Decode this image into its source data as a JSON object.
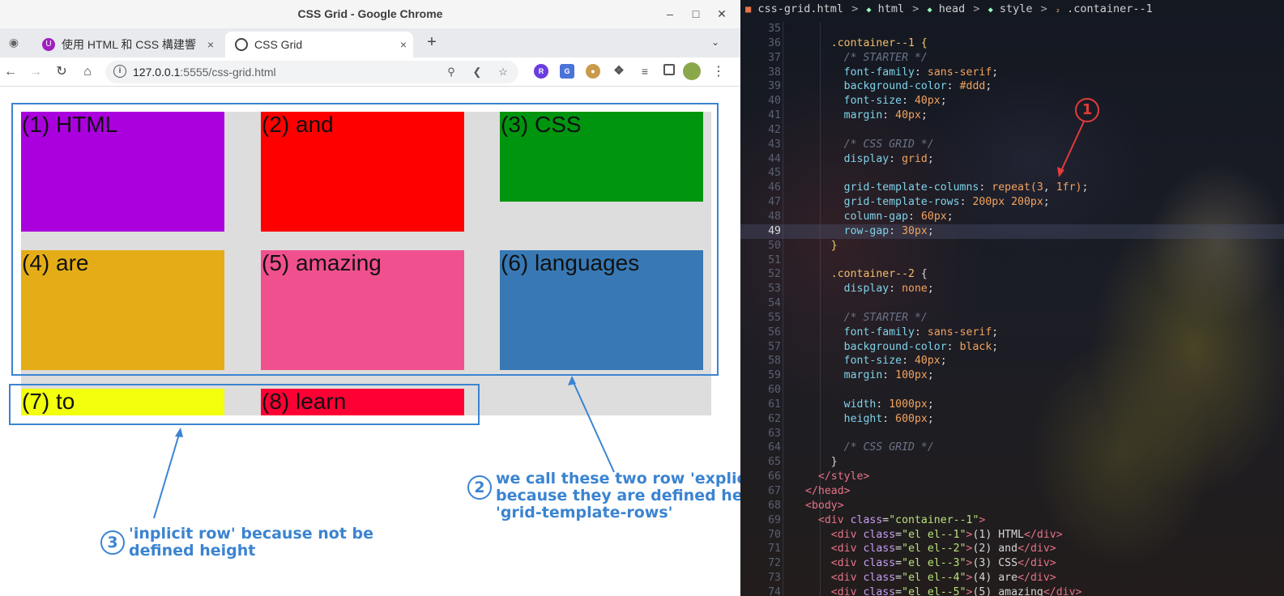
{
  "browser": {
    "window_title": "CSS Grid - Google Chrome",
    "tabs": [
      {
        "label": "使用 HTML 和 CSS 構建響",
        "active": false
      },
      {
        "label": "CSS Grid",
        "active": true
      }
    ],
    "url_host": "127.0.0.1",
    "url_rest": ":5555/css-grid.html",
    "new_tab": "+",
    "tab_close": "×"
  },
  "grid_items": [
    {
      "label": "(1) HTML",
      "color": "#aa00dd"
    },
    {
      "label": "(2) and",
      "color": "#ff0000"
    },
    {
      "label": "(3) CSS",
      "color": "#00950f"
    },
    {
      "label": "(4) are",
      "color": "#e4ad17"
    },
    {
      "label": "(5) amazing",
      "color": "#f1508f"
    },
    {
      "label": "(6) languages",
      "color": "#3879b5"
    },
    {
      "label": "(7) to",
      "color": "#f2ff0d"
    },
    {
      "label": "(8) learn",
      "color": "#ff0035"
    }
  ],
  "annotations": {
    "explicit_num": "2",
    "explicit_text": [
      "we call these two row 'explicit rows'",
      "because they are defined height by",
      "'grid-template-rows'"
    ],
    "implicit_num": "3",
    "implicit_text": [
      "'inplicit row' because not be",
      "defined height"
    ],
    "editor_num": "1"
  },
  "editor": {
    "breadcrumb": [
      "css-grid.html",
      "html",
      "head",
      "style",
      ".container--1"
    ],
    "current_line": 49,
    "lines": [
      {
        "n": 35,
        "parts": []
      },
      {
        "n": 36,
        "parts": [
          [
            "sel",
            "    .container--1 "
          ],
          [
            "br",
            "{"
          ]
        ]
      },
      {
        "n": 37,
        "parts": [
          [
            "cm",
            "      /* STARTER */"
          ]
        ]
      },
      {
        "n": 38,
        "parts": [
          [
            "prop",
            "      font-family"
          ],
          [
            "pl",
            ": "
          ],
          [
            "val",
            "sans-serif"
          ],
          [
            "pl",
            ";"
          ]
        ]
      },
      {
        "n": 39,
        "parts": [
          [
            "prop",
            "      background-color"
          ],
          [
            "pl",
            ": "
          ],
          [
            "val",
            "#ddd"
          ],
          [
            "pl",
            ";"
          ]
        ]
      },
      {
        "n": 40,
        "parts": [
          [
            "prop",
            "      font-size"
          ],
          [
            "pl",
            ": "
          ],
          [
            "val",
            "40px"
          ],
          [
            "pl",
            ";"
          ]
        ]
      },
      {
        "n": 41,
        "parts": [
          [
            "prop",
            "      margin"
          ],
          [
            "pl",
            ": "
          ],
          [
            "val",
            "40px"
          ],
          [
            "pl",
            ";"
          ]
        ]
      },
      {
        "n": 42,
        "parts": []
      },
      {
        "n": 43,
        "parts": [
          [
            "cm",
            "      /* CSS GRID */"
          ]
        ]
      },
      {
        "n": 44,
        "parts": [
          [
            "prop",
            "      display"
          ],
          [
            "pl",
            ": "
          ],
          [
            "val",
            "grid"
          ],
          [
            "pl",
            ";"
          ]
        ]
      },
      {
        "n": 45,
        "parts": []
      },
      {
        "n": 46,
        "parts": [
          [
            "prop",
            "      grid-template-columns"
          ],
          [
            "pl",
            ": "
          ],
          [
            "val",
            "repeat("
          ],
          [
            "val",
            "3"
          ],
          [
            "pl",
            ", "
          ],
          [
            "val",
            "1fr"
          ],
          [
            "val",
            ")"
          ],
          [
            "pl",
            ";"
          ]
        ]
      },
      {
        "n": 47,
        "parts": [
          [
            "prop",
            "      grid-template-rows"
          ],
          [
            "pl",
            ": "
          ],
          [
            "val",
            "200px 200px"
          ],
          [
            "pl",
            ";"
          ]
        ]
      },
      {
        "n": 48,
        "parts": [
          [
            "prop",
            "      column-gap"
          ],
          [
            "pl",
            ": "
          ],
          [
            "val",
            "60px"
          ],
          [
            "pl",
            ";"
          ]
        ]
      },
      {
        "n": 49,
        "parts": [
          [
            "prop",
            "      row-gap"
          ],
          [
            "pl",
            ": "
          ],
          [
            "val",
            "30px"
          ],
          [
            "pl",
            ";"
          ]
        ]
      },
      {
        "n": 50,
        "parts": [
          [
            "br",
            "    }"
          ]
        ]
      },
      {
        "n": 51,
        "parts": []
      },
      {
        "n": 52,
        "parts": [
          [
            "sel",
            "    .container--2 "
          ],
          [
            "pl",
            "{"
          ]
        ]
      },
      {
        "n": 53,
        "parts": [
          [
            "prop",
            "      display"
          ],
          [
            "pl",
            ": "
          ],
          [
            "val",
            "none"
          ],
          [
            "pl",
            ";"
          ]
        ]
      },
      {
        "n": 54,
        "parts": []
      },
      {
        "n": 55,
        "parts": [
          [
            "cm",
            "      /* STARTER */"
          ]
        ]
      },
      {
        "n": 56,
        "parts": [
          [
            "prop",
            "      font-family"
          ],
          [
            "pl",
            ": "
          ],
          [
            "val",
            "sans-serif"
          ],
          [
            "pl",
            ";"
          ]
        ]
      },
      {
        "n": 57,
        "parts": [
          [
            "prop",
            "      background-color"
          ],
          [
            "pl",
            ": "
          ],
          [
            "val",
            "black"
          ],
          [
            "pl",
            ";"
          ]
        ]
      },
      {
        "n": 58,
        "parts": [
          [
            "prop",
            "      font-size"
          ],
          [
            "pl",
            ": "
          ],
          [
            "val",
            "40px"
          ],
          [
            "pl",
            ";"
          ]
        ]
      },
      {
        "n": 59,
        "parts": [
          [
            "prop",
            "      margin"
          ],
          [
            "pl",
            ": "
          ],
          [
            "val",
            "100px"
          ],
          [
            "pl",
            ";"
          ]
        ]
      },
      {
        "n": 60,
        "parts": []
      },
      {
        "n": 61,
        "parts": [
          [
            "prop",
            "      width"
          ],
          [
            "pl",
            ": "
          ],
          [
            "val",
            "1000px"
          ],
          [
            "pl",
            ";"
          ]
        ]
      },
      {
        "n": 62,
        "parts": [
          [
            "prop",
            "      height"
          ],
          [
            "pl",
            ": "
          ],
          [
            "val",
            "600px"
          ],
          [
            "pl",
            ";"
          ]
        ]
      },
      {
        "n": 63,
        "parts": []
      },
      {
        "n": 64,
        "parts": [
          [
            "cm",
            "      /* CSS GRID */"
          ]
        ]
      },
      {
        "n": 65,
        "parts": [
          [
            "pl",
            "    }"
          ]
        ]
      },
      {
        "n": 66,
        "parts": [
          [
            "tag",
            "  </style>"
          ]
        ]
      },
      {
        "n": 67,
        "parts": [
          [
            "tag",
            "</head>"
          ]
        ]
      },
      {
        "n": 68,
        "parts": [
          [
            "tag",
            "<body>"
          ]
        ]
      },
      {
        "n": 69,
        "parts": [
          [
            "tag",
            "  <div "
          ],
          [
            "attr",
            "class"
          ],
          [
            "pl",
            "="
          ],
          [
            "str",
            "\"container--1\""
          ],
          [
            "tag",
            ">"
          ]
        ]
      },
      {
        "n": 70,
        "parts": [
          [
            "tag",
            "    <div "
          ],
          [
            "attr",
            "class"
          ],
          [
            "pl",
            "="
          ],
          [
            "str",
            "\"el el--1\""
          ],
          [
            "tag",
            ">"
          ],
          [
            "pl",
            "(1) HTML"
          ],
          [
            "tag",
            "</div>"
          ]
        ]
      },
      {
        "n": 71,
        "parts": [
          [
            "tag",
            "    <div "
          ],
          [
            "attr",
            "class"
          ],
          [
            "pl",
            "="
          ],
          [
            "str",
            "\"el el--2\""
          ],
          [
            "tag",
            ">"
          ],
          [
            "pl",
            "(2) and"
          ],
          [
            "tag",
            "</div>"
          ]
        ]
      },
      {
        "n": 72,
        "parts": [
          [
            "tag",
            "    <div "
          ],
          [
            "attr",
            "class"
          ],
          [
            "pl",
            "="
          ],
          [
            "str",
            "\"el el--3\""
          ],
          [
            "tag",
            ">"
          ],
          [
            "pl",
            "(3) CSS"
          ],
          [
            "tag",
            "</div>"
          ]
        ]
      },
      {
        "n": 73,
        "parts": [
          [
            "tag",
            "    <div "
          ],
          [
            "attr",
            "class"
          ],
          [
            "pl",
            "="
          ],
          [
            "str",
            "\"el el--4\""
          ],
          [
            "tag",
            ">"
          ],
          [
            "pl",
            "(4) are"
          ],
          [
            "tag",
            "</div>"
          ]
        ]
      },
      {
        "n": 74,
        "parts": [
          [
            "tag",
            "    <div "
          ],
          [
            "attr",
            "class"
          ],
          [
            "pl",
            "="
          ],
          [
            "str",
            "\"el el--5\""
          ],
          [
            "tag",
            ">"
          ],
          [
            "pl",
            "(5) amazing"
          ],
          [
            "tag",
            "</div>"
          ]
        ]
      }
    ]
  }
}
